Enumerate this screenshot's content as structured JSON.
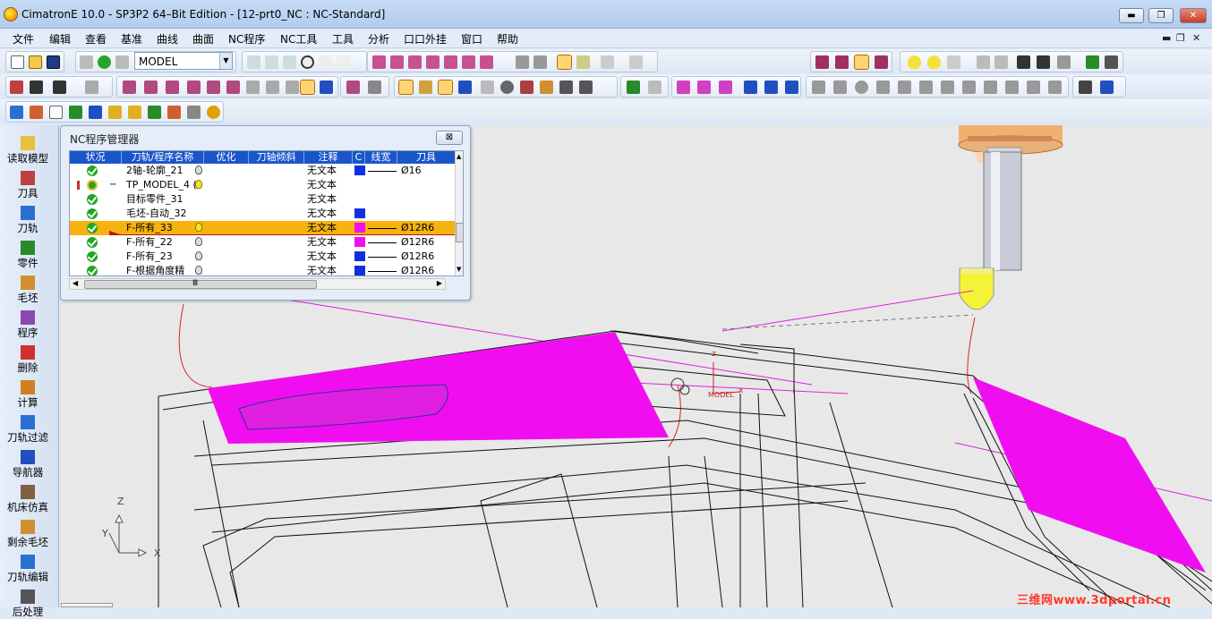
{
  "window": {
    "title": "CimatronE 10.0 - SP3P2 64–Bit Edition - [12-prt0_NC : NC-Standard]",
    "buttons": {
      "minimize": "▬",
      "restore": "❐",
      "close": "✕"
    }
  },
  "menubar": {
    "items": [
      "文件",
      "编辑",
      "查看",
      "基准",
      "曲线",
      "曲面",
      "NC程序",
      "NC工具",
      "工具",
      "分析",
      "口口外挂",
      "窗口",
      "帮助"
    ],
    "mdi_buttons": [
      "▬",
      "❐",
      "✕"
    ]
  },
  "toolbar": {
    "model_combo": "MODEL"
  },
  "sidebar": {
    "items": [
      "读取模型",
      "刀具",
      "刀轨",
      "零件",
      "毛坯",
      "程序",
      "删除",
      "计算",
      "刀轨过滤",
      "导航器",
      "机床仿真",
      "剩余毛坯",
      "刀轨编辑",
      "后处理"
    ]
  },
  "nc_manager": {
    "title": "NC程序管理器",
    "close_label": "⊠",
    "columns": [
      "状况",
      "刀轨/程序名称",
      "优化",
      "刀轴倾斜",
      "注释",
      "C",
      "线宽",
      "刀具"
    ],
    "rows": [
      {
        "name": "2轴-轮廓_21",
        "note": "无文本",
        "tool": "Ø16",
        "color": "#1030e0",
        "bulb": "off",
        "status": "ok",
        "selected": false
      },
      {
        "name": "TP_MODEL_4 (",
        "note": "无文本",
        "tool": "",
        "color": "",
        "bulb": "on",
        "status": "warn",
        "selected": false,
        "expander": "−"
      },
      {
        "name": "目标零件_31",
        "note": "无文本",
        "tool": "",
        "color": "",
        "bulb": "",
        "status": "ok",
        "selected": false
      },
      {
        "name": "毛坯-自动_32",
        "note": "无文本",
        "tool": "",
        "color": "#1030e0",
        "bulb": "",
        "status": "ok",
        "selected": false
      },
      {
        "name": "F-所有_33",
        "note": "无文本",
        "tool": "Ø12R6",
        "color": "#f00ef0",
        "bulb": "on",
        "status": "ok",
        "selected": true
      },
      {
        "name": "F-所有_22",
        "note": "无文本",
        "tool": "Ø12R6",
        "color": "#f00ef0",
        "bulb": "off",
        "status": "ok",
        "selected": false
      },
      {
        "name": "F-所有_23",
        "note": "无文本",
        "tool": "Ø12R6",
        "color": "#1030e0",
        "bulb": "off",
        "status": "ok",
        "selected": false
      },
      {
        "name": "F-根据角度精",
        "note": "无文本",
        "tool": "Ø12R6",
        "color": "#1030e0",
        "bulb": "off",
        "status": "ok",
        "selected": false
      }
    ],
    "hscroll_thumb": "Ⅲ"
  },
  "viewport": {
    "axis_labels": {
      "z": "Z",
      "y": "Y",
      "x": "X"
    },
    "model_labels": {
      "z": "z",
      "x": "x",
      "model": "MODEL"
    },
    "surface_color": "#f00ef0",
    "tool_color": "#f4f436"
  },
  "watermark": "三维网www.3dportal.cn"
}
